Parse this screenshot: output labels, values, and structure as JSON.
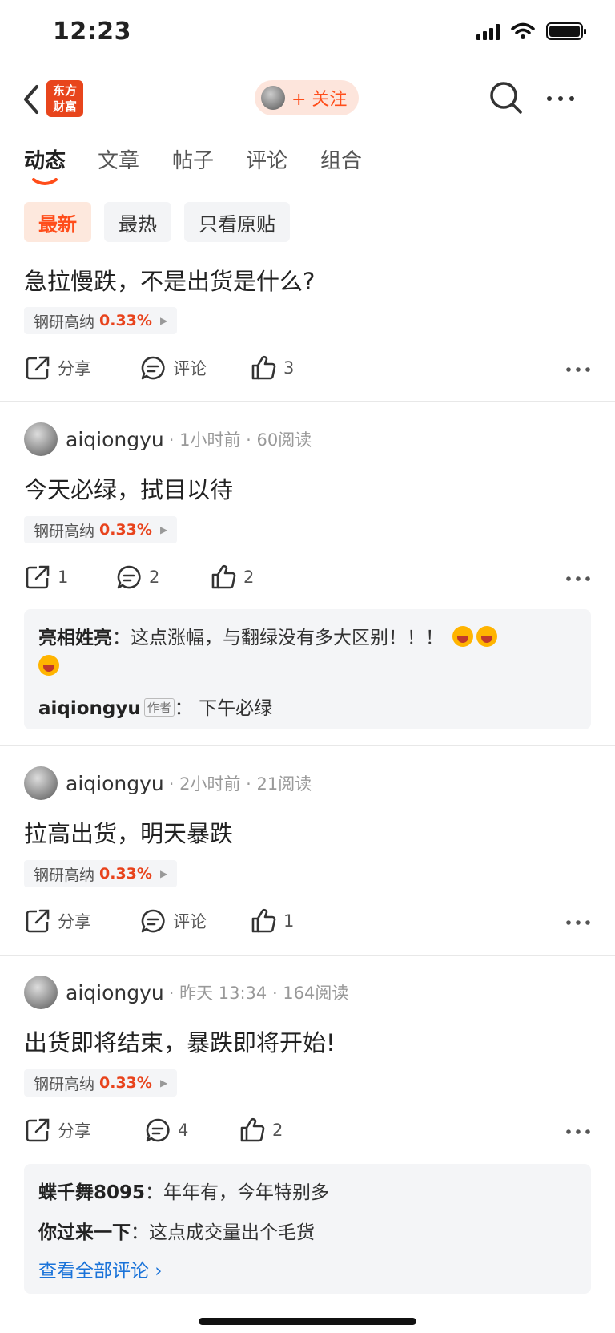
{
  "status": {
    "time": "12:23"
  },
  "nav": {
    "logo_line1": "东方",
    "logo_line2": "财富",
    "follow_label": "+ 关注"
  },
  "tabs": [
    "动态",
    "文章",
    "帖子",
    "评论",
    "组合"
  ],
  "filters": [
    "最新",
    "最热",
    "只看原贴"
  ],
  "labels": {
    "share": "分享",
    "comment": "评论"
  },
  "posts": [
    {
      "text": "急拉慢跌，不是出货是什么?",
      "stock": {
        "name": "钢研高纳",
        "pct": "0.33%"
      },
      "share": "分享",
      "comment": "评论",
      "likes": "3"
    },
    {
      "user": "aiqiongyu",
      "meta": "· 1小时前 · 60阅读",
      "text": "今天必绿，拭目以待",
      "stock": {
        "name": "钢研高纳",
        "pct": "0.33%"
      },
      "share": "1",
      "comment": "2",
      "likes": "2",
      "comments": [
        {
          "who": "亮相姓亮",
          "text": "：这点涨幅，与翻绿没有多大区别！！！"
        },
        {
          "who": "aiqiongyu",
          "tag": "作者",
          "text": "： 下午必绿"
        }
      ]
    },
    {
      "user": "aiqiongyu",
      "meta": "· 2小时前 · 21阅读",
      "text": "拉高出货，明天暴跌",
      "stock": {
        "name": "钢研高纳",
        "pct": "0.33%"
      },
      "share": "分享",
      "comment": "评论",
      "likes": "1"
    },
    {
      "user": "aiqiongyu",
      "meta": "· 昨天 13:34 · 164阅读",
      "text": "出货即将结束，暴跌即将开始!",
      "stock": {
        "name": "钢研高纳",
        "pct": "0.33%"
      },
      "share": "分享",
      "comment": "4",
      "likes": "2",
      "comments": [
        {
          "who": "蝶千舞8095",
          "text": "：年年有，今年特别多"
        },
        {
          "who": "你过来一下",
          "text": "：这点成交量出个毛货"
        }
      ],
      "view_all": "查看全部评论 ›"
    }
  ],
  "colors": {
    "accent": "#ff4d1a",
    "stock_up": "#e8431c",
    "link": "#1a73d9"
  }
}
